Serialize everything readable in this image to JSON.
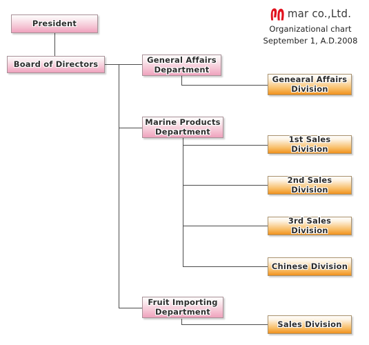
{
  "header": {
    "logo_icon": "mar-logo-mark",
    "logo_color": "#e1121e",
    "wordmark": "mar co.,Ltd.",
    "title": "Organizational chart",
    "date": "September 1, A.D.2008"
  },
  "theme": {
    "pink_top": "#fdfbfb",
    "pink_bottom": "#efa2bd",
    "orange_top": "#fffdfa",
    "orange_bottom": "#f0911e",
    "line_color": "#4a4a4a",
    "text_color": "#2b2b2b"
  },
  "chart_data": {
    "type": "diagram",
    "title": "Organizational chart",
    "subtitle": "September 1, A.D.2008",
    "organization": "mar co.,Ltd.",
    "nodes": [
      {
        "id": "president",
        "label": "President",
        "level": 0,
        "style": "pink"
      },
      {
        "id": "board",
        "label": "Board of Directors",
        "level": 1,
        "style": "pink"
      },
      {
        "id": "general_dept",
        "label": "General Affairs Department",
        "label_line1": "General Affairs",
        "label_line2": "Department",
        "level": 2,
        "style": "pink"
      },
      {
        "id": "marine_dept",
        "label": "Marine Products Department",
        "label_line1": "Marine Products",
        "label_line2": "Department",
        "level": 2,
        "style": "pink"
      },
      {
        "id": "fruit_dept",
        "label": "Fruit Importing Department",
        "label_line1": "Fruit Importing",
        "label_line2": "Department",
        "level": 2,
        "style": "pink"
      },
      {
        "id": "general_div",
        "label": "Genearal Affairs Division",
        "label_line1": "Genearal Affairs",
        "label_line2": "Division",
        "level": 3,
        "style": "orange"
      },
      {
        "id": "sales1_div",
        "label": "1st Sales Division",
        "level": 3,
        "style": "orange"
      },
      {
        "id": "sales2_div",
        "label": "2nd Sales Division",
        "level": 3,
        "style": "orange"
      },
      {
        "id": "sales3_div",
        "label": "3rd Sales Division",
        "level": 3,
        "style": "orange"
      },
      {
        "id": "chinese_div",
        "label": "Chinese Division",
        "level": 3,
        "style": "orange"
      },
      {
        "id": "fruit_sales_div",
        "label": "Sales Division",
        "level": 3,
        "style": "orange"
      }
    ],
    "edges": [
      {
        "from": "president",
        "to": "board"
      },
      {
        "from": "board",
        "to": "general_dept"
      },
      {
        "from": "board",
        "to": "marine_dept"
      },
      {
        "from": "board",
        "to": "fruit_dept"
      },
      {
        "from": "general_dept",
        "to": "general_div"
      },
      {
        "from": "marine_dept",
        "to": "sales1_div"
      },
      {
        "from": "marine_dept",
        "to": "sales2_div"
      },
      {
        "from": "marine_dept",
        "to": "sales3_div"
      },
      {
        "from": "marine_dept",
        "to": "chinese_div"
      },
      {
        "from": "fruit_dept",
        "to": "fruit_sales_div"
      }
    ]
  }
}
